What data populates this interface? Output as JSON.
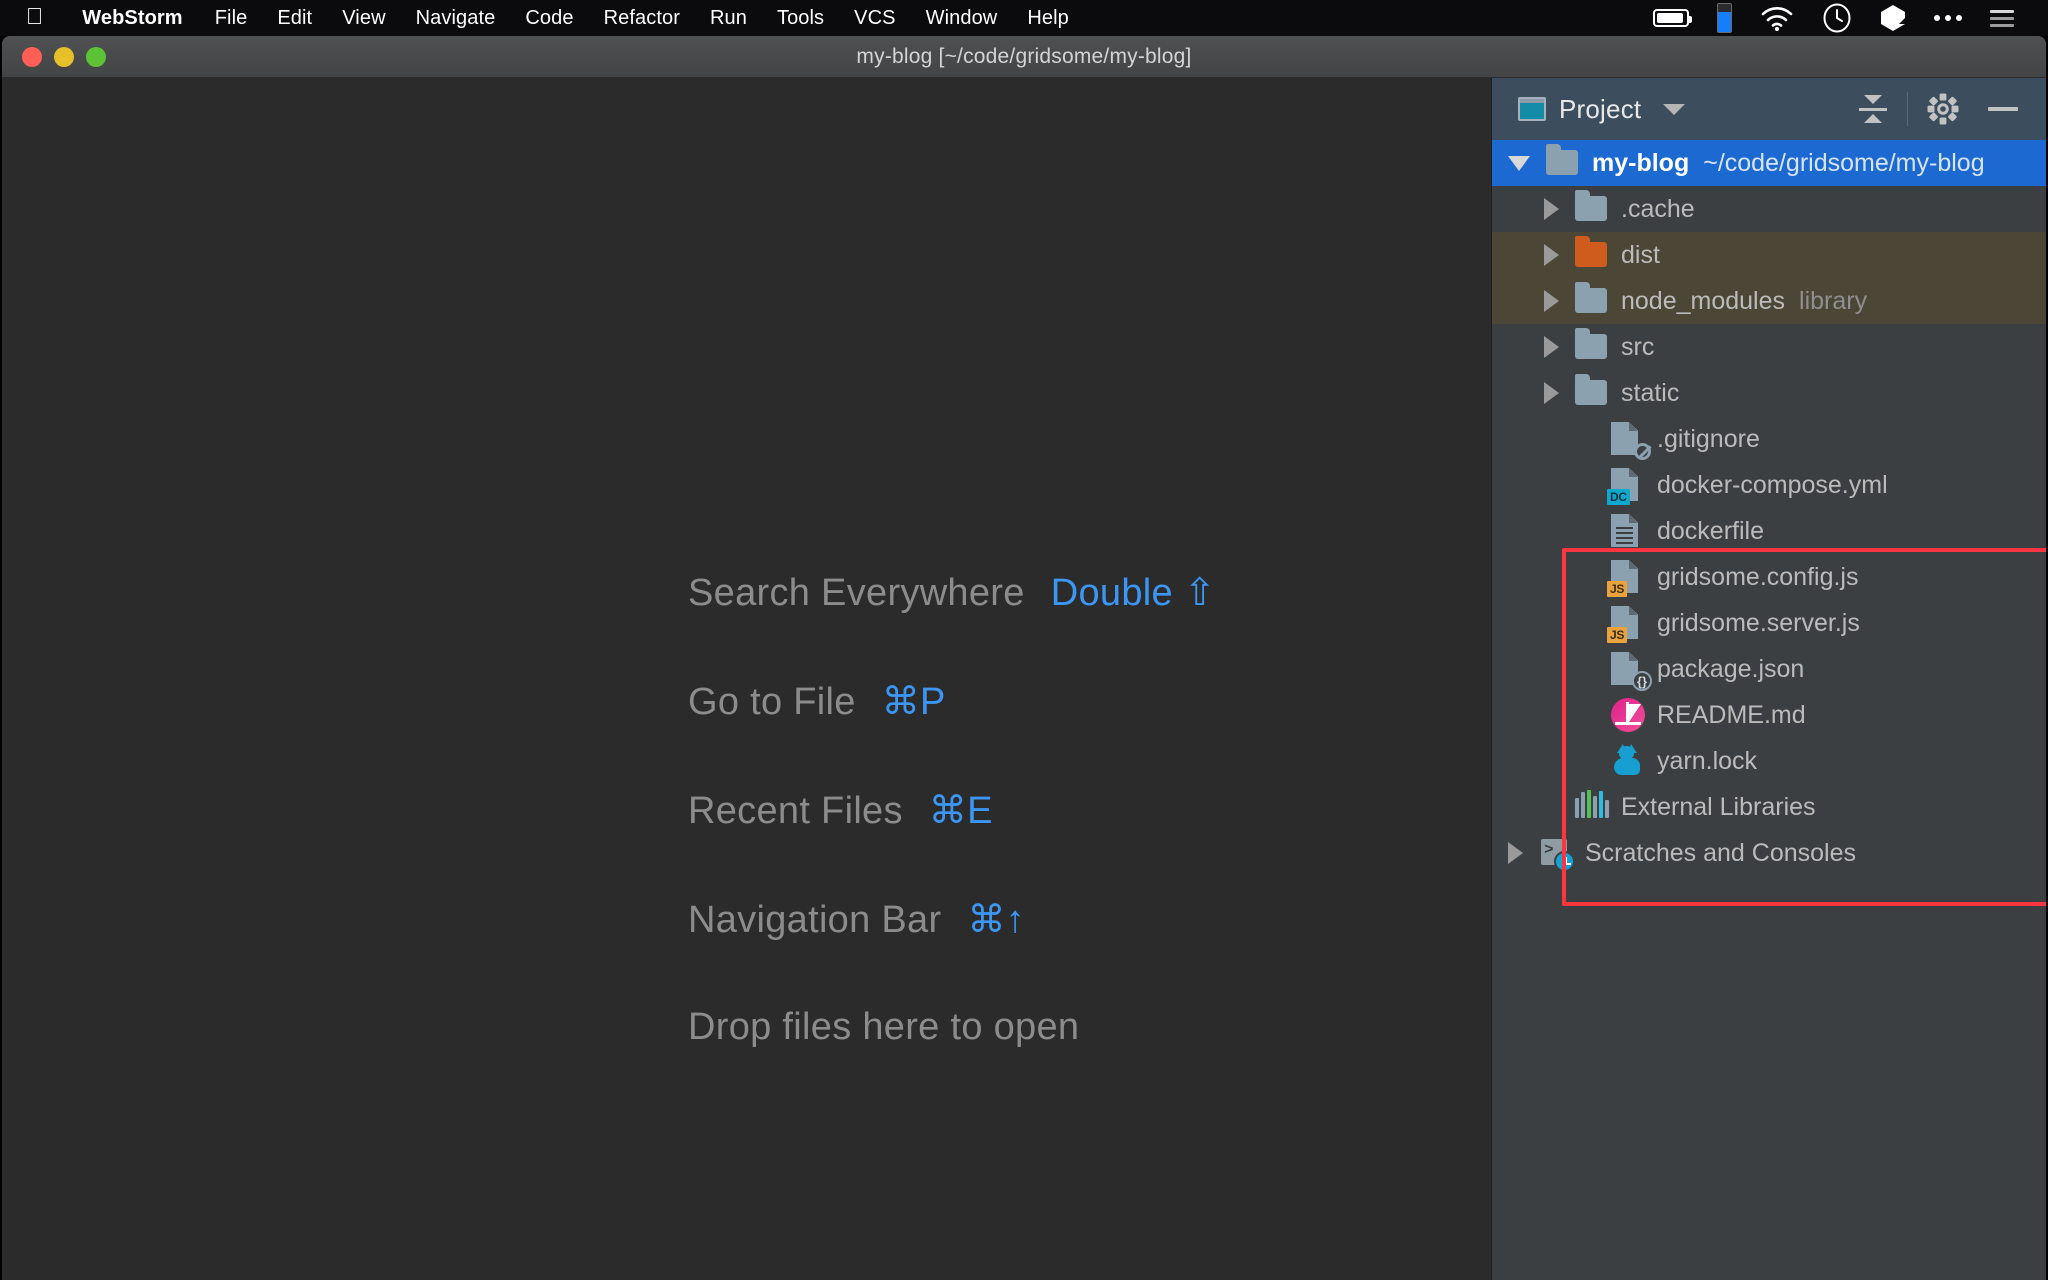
{
  "menubar": {
    "apple_icon": "apple-logo",
    "items": [
      {
        "label": "WebStorm",
        "bold": true
      },
      {
        "label": "File"
      },
      {
        "label": "Edit"
      },
      {
        "label": "View"
      },
      {
        "label": "Navigate"
      },
      {
        "label": "Code"
      },
      {
        "label": "Refactor"
      },
      {
        "label": "Run"
      },
      {
        "label": "Tools"
      },
      {
        "label": "VCS"
      },
      {
        "label": "Window"
      },
      {
        "label": "Help"
      }
    ],
    "tray": [
      {
        "name": "battery-icon"
      },
      {
        "name": "blue-indicator-icon"
      },
      {
        "name": "wifi-icon"
      },
      {
        "name": "clock-icon"
      },
      {
        "name": "app-glyph-icon"
      },
      {
        "name": "ellipsis-icon"
      },
      {
        "name": "control-center-list-icon"
      }
    ]
  },
  "window": {
    "title": "my-blog [~/code/gridsome/my-blog]",
    "traffic": {
      "close": "close-button",
      "minimize": "minimize-button",
      "maximize": "maximize-button"
    }
  },
  "editor": {
    "hints": [
      {
        "label": "Search Everywhere",
        "shortcut": "Double ⇧"
      },
      {
        "label": "Go to File",
        "shortcut": "⌘P"
      },
      {
        "label": "Recent Files",
        "shortcut": "⌘E"
      },
      {
        "label": "Navigation Bar",
        "shortcut": "⌘↑"
      },
      {
        "label": "Drop files here to open",
        "shortcut": ""
      }
    ]
  },
  "project_panel": {
    "header": {
      "title": "Project",
      "icon": "project-window-icon",
      "dropdown": "chevron-down-icon",
      "collapse_all": "collapse-all-icon",
      "settings": "gear-icon",
      "hide": "minimize-icon"
    },
    "tree": [
      {
        "label": "my-blog",
        "path": "~/code/gridsome/my-blog",
        "icon": "folder-icon",
        "arrow": "expanded",
        "indent": 1,
        "selected": true
      },
      {
        "label": ".cache",
        "icon": "folder-icon",
        "arrow": "collapsed",
        "indent": 2
      },
      {
        "label": "dist",
        "icon": "folder-orange-icon",
        "arrow": "collapsed",
        "indent": 2,
        "excluded": true
      },
      {
        "label": "node_modules",
        "tag": "library",
        "icon": "folder-icon",
        "arrow": "collapsed",
        "indent": 2,
        "excluded": true
      },
      {
        "label": "src",
        "icon": "folder-icon",
        "arrow": "collapsed",
        "indent": 2
      },
      {
        "label": "static",
        "icon": "folder-icon",
        "arrow": "collapsed",
        "indent": 2
      },
      {
        "label": ".gitignore",
        "icon": "file-ignored-icon",
        "arrow": "none",
        "indent": 3
      },
      {
        "label": "docker-compose.yml",
        "icon": "file-dc-icon",
        "badge": "DC",
        "arrow": "none",
        "indent": 3
      },
      {
        "label": "dockerfile",
        "icon": "file-text-icon",
        "arrow": "none",
        "indent": 3
      },
      {
        "label": "gridsome.config.js",
        "icon": "file-js-icon",
        "badge": "JS",
        "arrow": "none",
        "indent": 3
      },
      {
        "label": "gridsome.server.js",
        "icon": "file-js-icon",
        "badge": "JS",
        "arrow": "none",
        "indent": 3
      },
      {
        "label": "package.json",
        "icon": "file-json-icon",
        "arrow": "none",
        "indent": 3
      },
      {
        "label": "README.md",
        "icon": "markdown-icon",
        "arrow": "none",
        "indent": 3
      },
      {
        "label": "yarn.lock",
        "icon": "yarn-icon",
        "arrow": "none",
        "indent": 3
      },
      {
        "label": "External Libraries",
        "icon": "external-libraries-icon",
        "arrow": "none",
        "indent": 2
      },
      {
        "label": "Scratches and Consoles",
        "icon": "scratches-icon",
        "arrow": "collapsed",
        "indent": 1
      }
    ],
    "annotation": {
      "name": "red-highlight-box",
      "color": "#fb3640"
    }
  },
  "colors": {
    "accent_blue": "#3c96f4",
    "selection_blue": "#1d69d2",
    "excluded_bg": "#4c4636",
    "panel_bg": "#3c3f41",
    "editor_bg": "#2b2b2b",
    "header_bg": "#3c4e5e",
    "annotation_red": "#fb3640",
    "js_badge": "#e8a33d",
    "dc_badge": "#0fa8cd",
    "folder_orange": "#cf5c1c",
    "markdown_pink": "#e0218a",
    "yarn_blue": "#169fd0"
  }
}
